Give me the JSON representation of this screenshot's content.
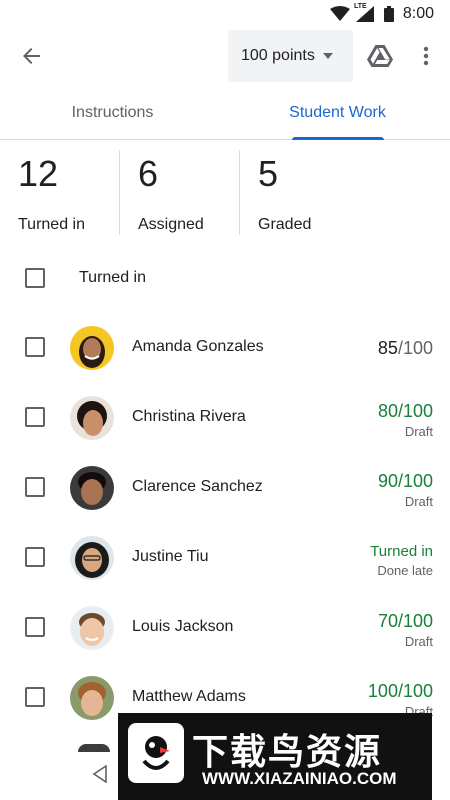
{
  "status_bar": {
    "time": "8:00",
    "network": "LTE"
  },
  "app_bar": {
    "back_icon": "arrow-back-icon",
    "points_value": "100 points",
    "drive_icon": "google-drive-icon",
    "more_icon": "more-vert-icon"
  },
  "tabs": [
    {
      "label": "Instructions",
      "active": false
    },
    {
      "label": "Student Work",
      "active": true
    }
  ],
  "stats": [
    {
      "value": "12",
      "label": "Turned in"
    },
    {
      "value": "6",
      "label": "Assigned"
    },
    {
      "value": "5",
      "label": "Graded"
    }
  ],
  "section": {
    "label": "Turned in"
  },
  "students": [
    {
      "name": "Amanda Gonzales",
      "score": "85",
      "max": "/100",
      "status": ""
    },
    {
      "name": "Christina Rivera",
      "grade": "80/100",
      "status": "Draft"
    },
    {
      "name": "Clarence Sanchez",
      "grade": "90/100",
      "status": "Draft"
    },
    {
      "name": "Justine Tiu",
      "grade": "Turned in",
      "status": "Done late"
    },
    {
      "name": "Louis Jackson",
      "grade": "70/100",
      "status": "Draft"
    },
    {
      "name": "Matthew Adams",
      "grade": "100/100",
      "status": "Draft"
    }
  ],
  "watermark": {
    "title": "下载鸟资源",
    "url": "WWW.XIAZAINIAO.COM"
  },
  "colors": {
    "accent": "#1967d2",
    "green": "#188038",
    "text": "#202124",
    "secondary": "#5f6368"
  }
}
